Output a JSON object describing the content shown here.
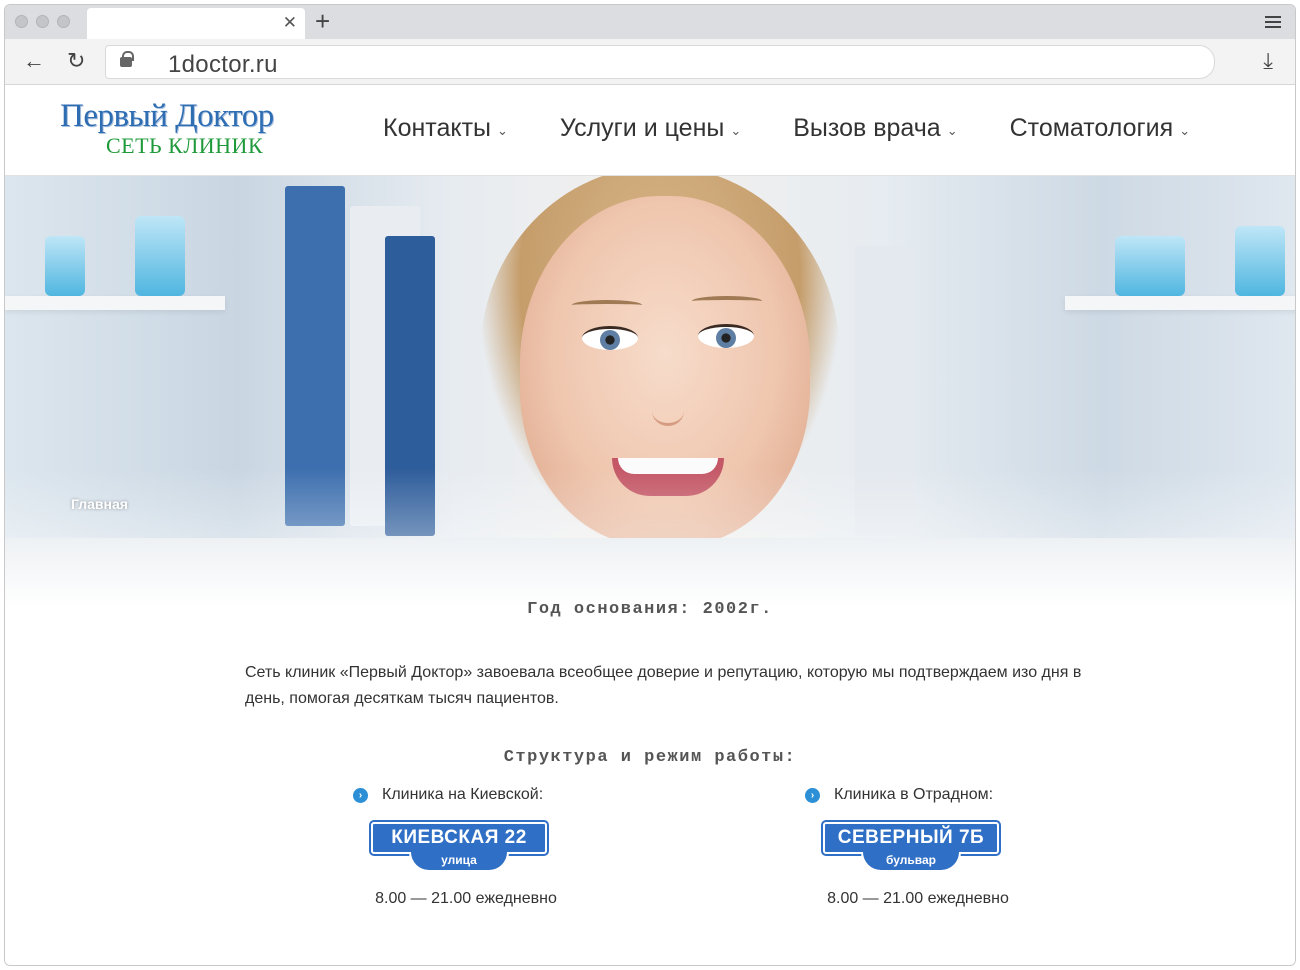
{
  "browser": {
    "url": "1doctor.ru"
  },
  "header": {
    "logo_title": "Первый Доктор",
    "logo_subtitle": "СЕТЬ КЛИНИК",
    "nav": [
      {
        "label": "Контакты"
      },
      {
        "label": "Услуги и цены"
      },
      {
        "label": "Вызов врача"
      },
      {
        "label": "Стоматология"
      }
    ]
  },
  "hero": {
    "breadcrumb": "Главная"
  },
  "content": {
    "founded": "Год основания: 2002г.",
    "intro": "Сеть клиник «Первый Доктор» завоевала всеобщее доверие и репутацию, которую мы подтверждаем изо дня в день, помогая десяткам тысяч пациентов.",
    "structure_title": "Структура и режим работы:",
    "clinics": [
      {
        "title": "Клиника на Киевской:",
        "sign_main": "КИЕВСКАЯ 22",
        "sign_sub": "улица",
        "hours": "8.00 — 21.00 ежедневно"
      },
      {
        "title": "Клиника в Отрадном:",
        "sign_main": "СЕВЕРНЫЙ 7Б",
        "sign_sub": "бульвар",
        "hours": "8.00 — 21.00 ежедневно"
      }
    ]
  },
  "colors": {
    "accent": "#2f6fc5",
    "logo_blue": "#2f6db3",
    "logo_green": "#1f9a3a"
  }
}
